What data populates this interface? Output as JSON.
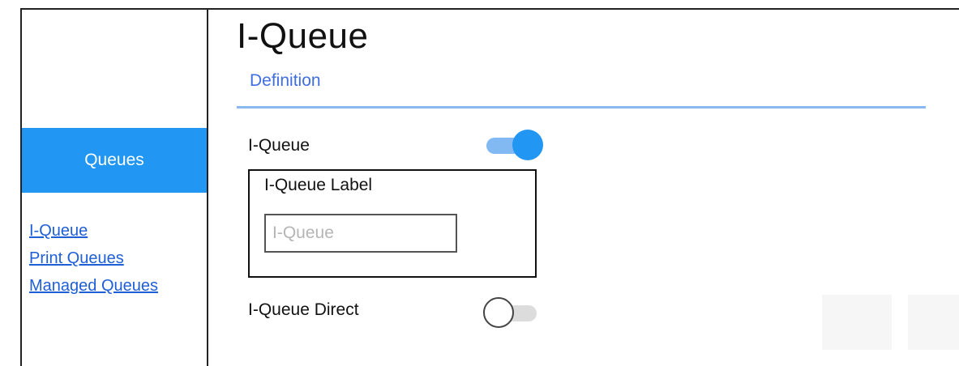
{
  "sidebar": {
    "active_item": "Queues",
    "links": [
      "I-Queue",
      "Print Queues",
      "Managed Queues"
    ]
  },
  "main": {
    "title": "I-Queue",
    "tab": "Definition",
    "iqueue_toggle": {
      "label": "I-Queue",
      "state": "on"
    },
    "label_box": {
      "title": "I-Queue Label",
      "input_placeholder": "I-Queue",
      "input_value": ""
    },
    "direct_toggle": {
      "label": "I-Queue Direct",
      "state": "off"
    }
  },
  "colors": {
    "accent": "#2196f3",
    "link": "#1f5fd6",
    "tab": "#3f6ee0"
  }
}
